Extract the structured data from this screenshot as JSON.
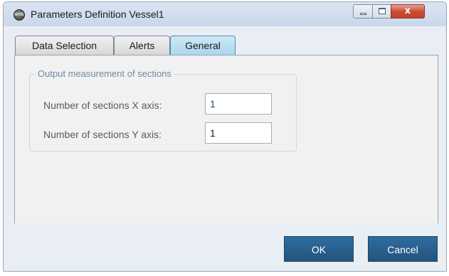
{
  "window": {
    "title": "Parameters Definition Vessel1",
    "icon": "app-logo-icon",
    "icon_text": "AITIS"
  },
  "window_controls": {
    "minimize": "minimize-icon",
    "maximize": "maximize-icon",
    "close": "close-icon",
    "close_glyph": "x"
  },
  "tabs": [
    {
      "label": "Data Selection",
      "active": false
    },
    {
      "label": "Alerts",
      "active": false
    },
    {
      "label": "General",
      "active": true
    }
  ],
  "general": {
    "group_title": "Output measurement of sections",
    "fields": [
      {
        "label": "Number of sections X axis:",
        "value": "1"
      },
      {
        "label": "Number of sections Y axis:",
        "value": "1"
      }
    ]
  },
  "buttons": {
    "ok": "OK",
    "cancel": "Cancel"
  },
  "colors": {
    "accent": "#2a5f8c",
    "active_tab": "#b7dff2",
    "close_button": "#c9492f"
  }
}
